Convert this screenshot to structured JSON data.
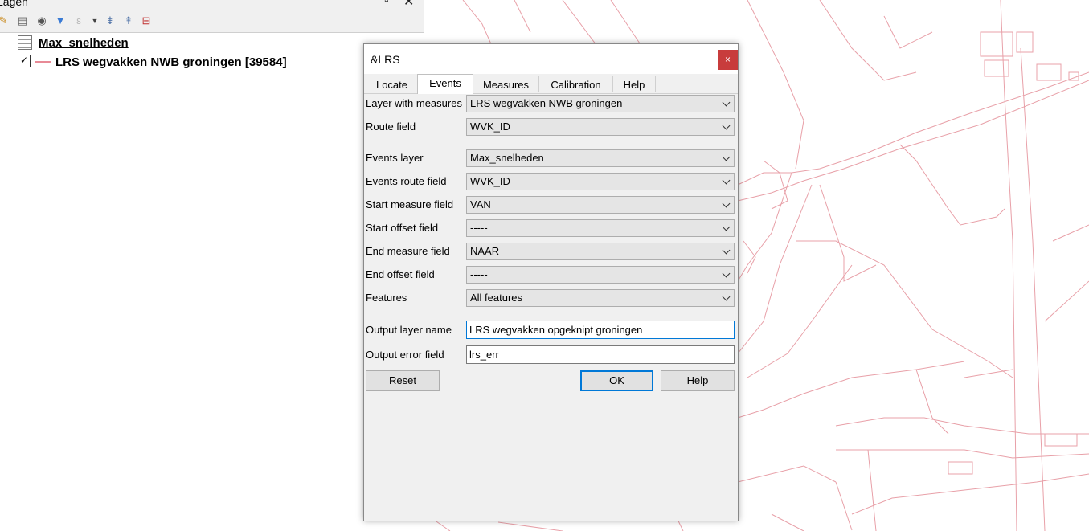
{
  "layers_panel": {
    "title": "Lagen",
    "layers": [
      {
        "name": "Max_snelheden",
        "type": "table"
      },
      {
        "name": "LRS wegvakken NWB  groningen [39584]",
        "type": "line",
        "checked": true,
        "symbol_color": "#e88a96"
      }
    ],
    "toolbar_icons": [
      "style-manager-icon",
      "add-group-icon",
      "visibility-icon",
      "filter-icon",
      "expression-filter-icon",
      "dropdown-arrow-icon",
      "expand-all-icon",
      "collapse-all-icon",
      "remove-layer-icon"
    ]
  },
  "map": {
    "line_color": "#e8a0a8",
    "background": "#ffffff"
  },
  "dialog": {
    "title": "&LRS",
    "close_label": "×",
    "tabs": [
      "Locate",
      "Events",
      "Measures",
      "Calibration",
      "Help"
    ],
    "active_tab": "Events",
    "fields": {
      "layer_with_measures": {
        "label": "Layer with measures",
        "value": "LRS wegvakken NWB  groningen"
      },
      "route_field": {
        "label": "Route field",
        "value": "WVK_ID"
      },
      "events_layer": {
        "label": "Events layer",
        "value": "Max_snelheden"
      },
      "events_route_field": {
        "label": "Events route field",
        "value": "WVK_ID"
      },
      "start_measure_field": {
        "label": "Start measure field",
        "value": "VAN"
      },
      "start_offset_field": {
        "label": "Start offset field",
        "value": "-----"
      },
      "end_measure_field": {
        "label": "End measure field",
        "value": "NAAR"
      },
      "end_offset_field": {
        "label": "End offset field",
        "value": "-----"
      },
      "features": {
        "label": "Features",
        "value": "All features"
      },
      "output_layer_name": {
        "label": "Output layer name",
        "value": "LRS wegvakken opgeknipt groningen"
      },
      "output_error_field": {
        "label": "Output error field",
        "value": "lrs_err"
      }
    },
    "buttons": {
      "reset": "Reset",
      "ok": "OK",
      "help": "Help"
    }
  }
}
